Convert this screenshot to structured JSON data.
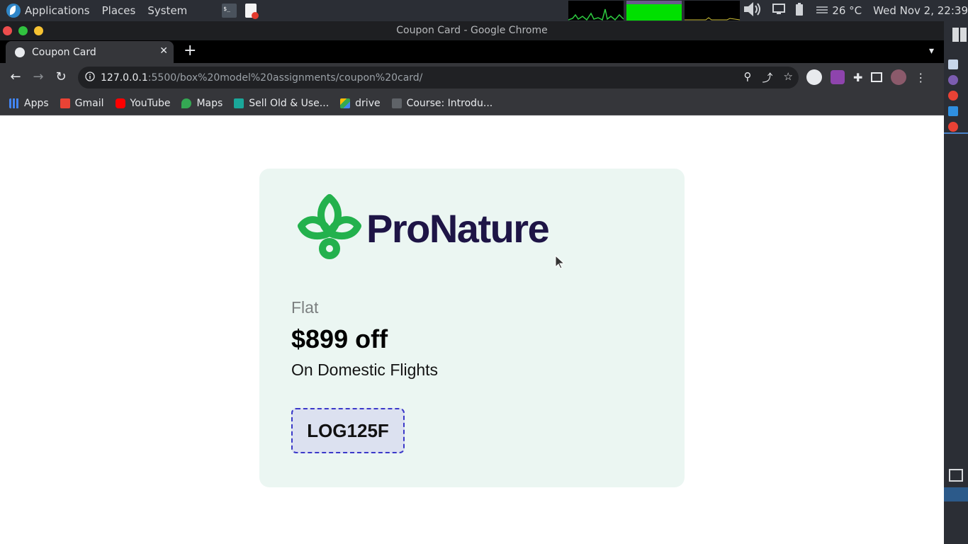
{
  "system_panel": {
    "menus": [
      "Applications",
      "Places",
      "System"
    ],
    "temperature": "26 °C",
    "clock": "Wed Nov  2, 22:39"
  },
  "window": {
    "title": "Coupon Card - Google Chrome"
  },
  "tabs": [
    {
      "label": "Coupon Card",
      "active": true
    }
  ],
  "toolbar": {
    "url_host": "127.0.0.1",
    "url_path": ":5500/box%20model%20assignments/coupon%20card/"
  },
  "bookmarks": [
    {
      "label": "Apps",
      "icon": "apps-grid-icon",
      "color": "#4285f4"
    },
    {
      "label": "Gmail",
      "icon": "gmail-icon",
      "color": "#ea4335"
    },
    {
      "label": "YouTube",
      "icon": "youtube-icon",
      "color": "#ff0000"
    },
    {
      "label": "Maps",
      "icon": "maps-icon",
      "color": "#34a853"
    },
    {
      "label": "Sell Old & Use...",
      "icon": "cashify-icon",
      "color": "#1aa79a"
    },
    {
      "label": "drive",
      "icon": "drive-icon",
      "color": "#fbbc04"
    },
    {
      "label": "Course: Introdu...",
      "icon": "course-icon",
      "color": "#6b6b6b"
    }
  ],
  "coupon": {
    "brand": "ProNature",
    "brand_color": "#1e1546",
    "leaf_color": "#23b14d",
    "flat_label": "Flat",
    "amount": "$899 off",
    "description": "On Domestic Flights",
    "code": "LOG125F",
    "card_background": "#ebf6f2",
    "code_border_color": "#3b39c9"
  }
}
